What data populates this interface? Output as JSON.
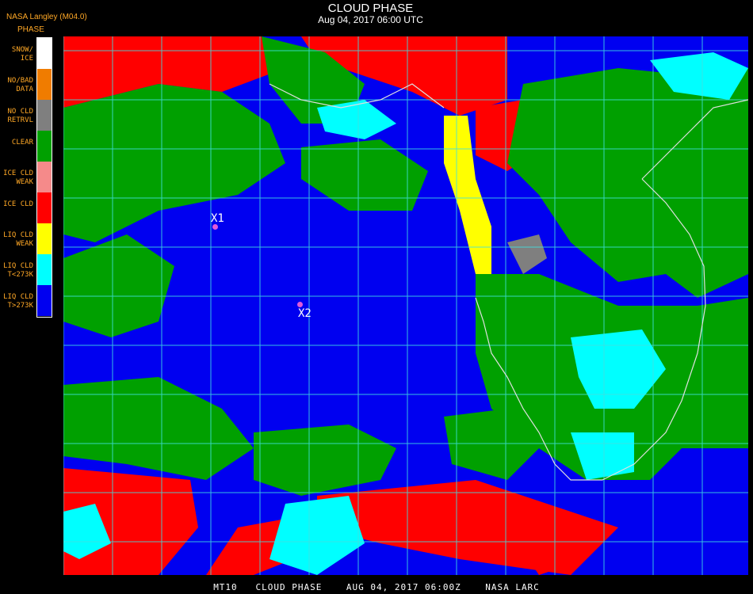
{
  "header": {
    "org": "NASA Langley (M04.0)",
    "phase_label": "PHASE",
    "title": "CLOUD PHASE",
    "subtitle": "Aug 04, 2017 06:00 UTC"
  },
  "legend": [
    {
      "line1": "SNOW/",
      "line2": "ICE",
      "color": "#ffffff"
    },
    {
      "line1": "NO/BAD",
      "line2": "DATA",
      "color": "#f07c00"
    },
    {
      "line1": "NO CLD",
      "line2": "RETRVL",
      "color": "#7f7f7f"
    },
    {
      "line1": "CLEAR",
      "line2": "",
      "color": "#00a000"
    },
    {
      "line1": "ICE CLD",
      "line2": "WEAK",
      "color": "#f58a8a"
    },
    {
      "line1": "ICE CLD",
      "line2": "",
      "color": "#ff0000"
    },
    {
      "line1": "LIQ CLD",
      "line2": "WEAK",
      "color": "#ffff00"
    },
    {
      "line1": "LIQ CLD",
      "line2": "T<273K",
      "color": "#00ffff"
    },
    {
      "line1": "LIQ CLD",
      "line2": "T>273K",
      "color": "#0000f0"
    }
  ],
  "markers": [
    {
      "label": "X1"
    },
    {
      "label": "X2"
    }
  ],
  "footer": "MT10   CLOUD PHASE    AUG 04, 2017 06:00Z    NASA LARC"
}
